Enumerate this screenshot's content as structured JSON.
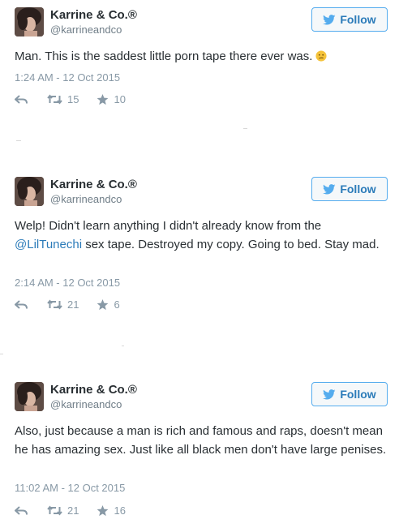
{
  "colors": {
    "link_blue": "#2b7bb9",
    "follow_border": "#55acee",
    "meta_gray": "#8899a6",
    "text": "#292f33"
  },
  "icons": {
    "follow": "twitter-bird-icon",
    "reply": "reply-arrow-icon",
    "retweet": "retweet-icon",
    "favorite": "star-icon",
    "emoji": "confused-face-emoji"
  },
  "tweets": [
    {
      "name": "Karrine & Co.®",
      "handle": "@karrineandco",
      "follow_label": "Follow",
      "text": "Man. This is the saddest little porn tape there ever was.",
      "timestamp": "1:24 AM - 12 Oct 2015",
      "retweets": "15",
      "favorites": "10"
    },
    {
      "name": "Karrine & Co.®",
      "handle": "@karrineandco",
      "follow_label": "Follow",
      "text_before": "Welp! Didn't learn anything I didn't already know from the ",
      "mention": "@LilTunechi",
      "text_after": " sex tape. Destroyed my copy. Going to bed. Stay mad.",
      "timestamp": "2:14 AM - 12 Oct 2015",
      "retweets": "21",
      "favorites": "6"
    },
    {
      "name": "Karrine & Co.®",
      "handle": "@karrineandco",
      "follow_label": "Follow",
      "text": "Also, just because a man is rich and famous and raps, doesn't mean he has amazing sex. Just like all black men don't have large penises.",
      "timestamp": "11:02 AM - 12 Oct 2015",
      "retweets": "21",
      "favorites": "16"
    }
  ]
}
